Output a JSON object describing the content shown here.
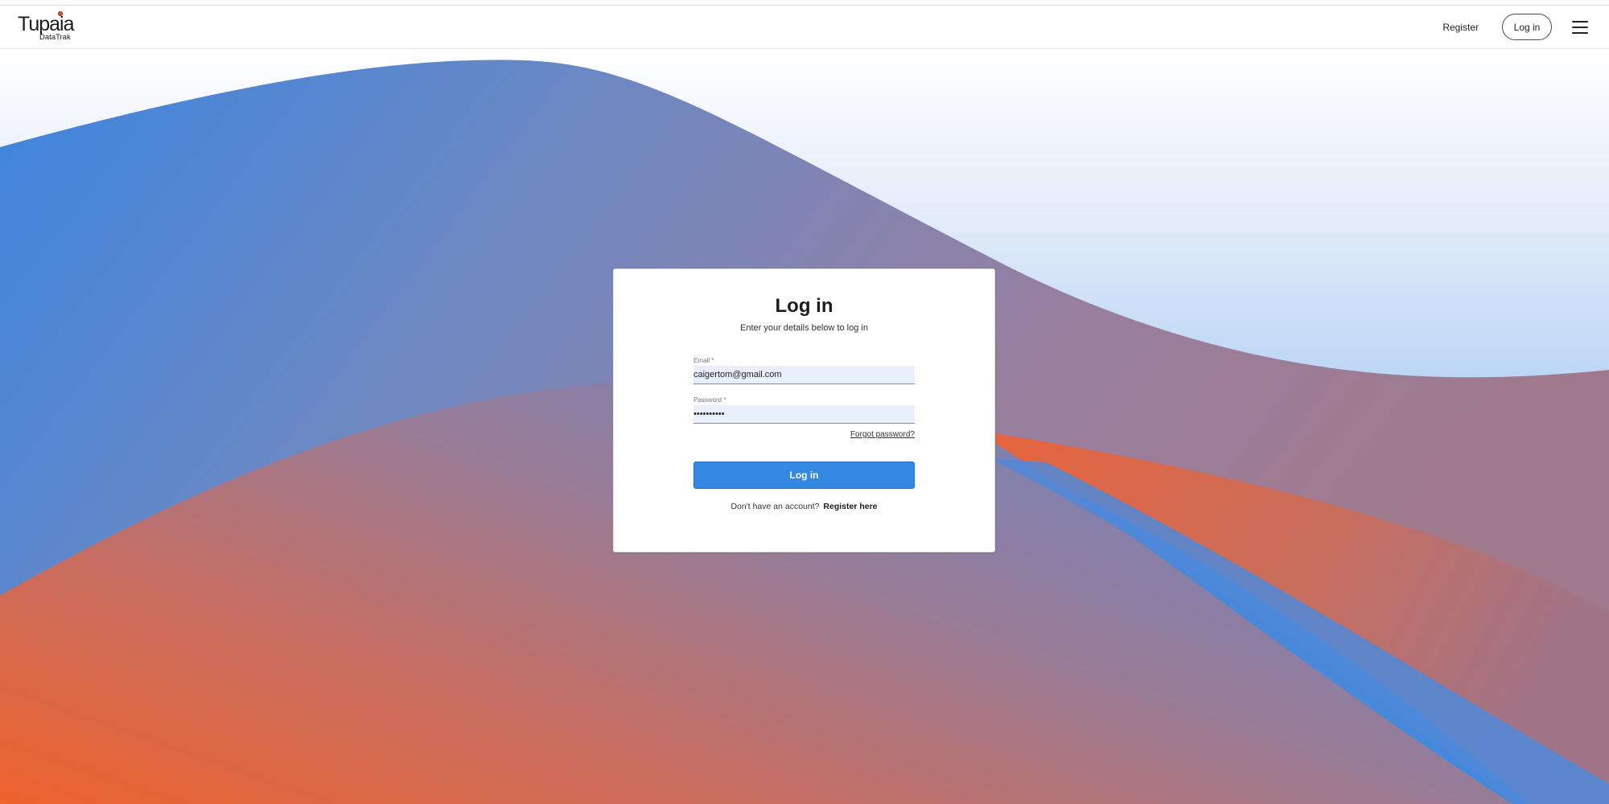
{
  "header": {
    "logo_text": "Tupaia",
    "logo_subtext": "DataTrak",
    "register_label": "Register",
    "login_label": "Log in",
    "menu_icon": "hamburger-menu-icon"
  },
  "login_form": {
    "title": "Log in",
    "subtitle": "Enter your details below to log in",
    "email_label": "Email *",
    "email_value": "caigertom@gmail.com",
    "password_label": "Password *",
    "password_value": "••••••••••",
    "forgot_password_label": "Forgot password?",
    "submit_label": "Log in",
    "no_account_text": "Don't have an account?",
    "register_link_label": "Register here"
  },
  "colors": {
    "primary_button": "#3388e1",
    "background_blue": "#3a88e0",
    "background_orange": "#ec622d",
    "background_mauve": "#9a7f9e",
    "input_fill": "#e8f0fe"
  }
}
